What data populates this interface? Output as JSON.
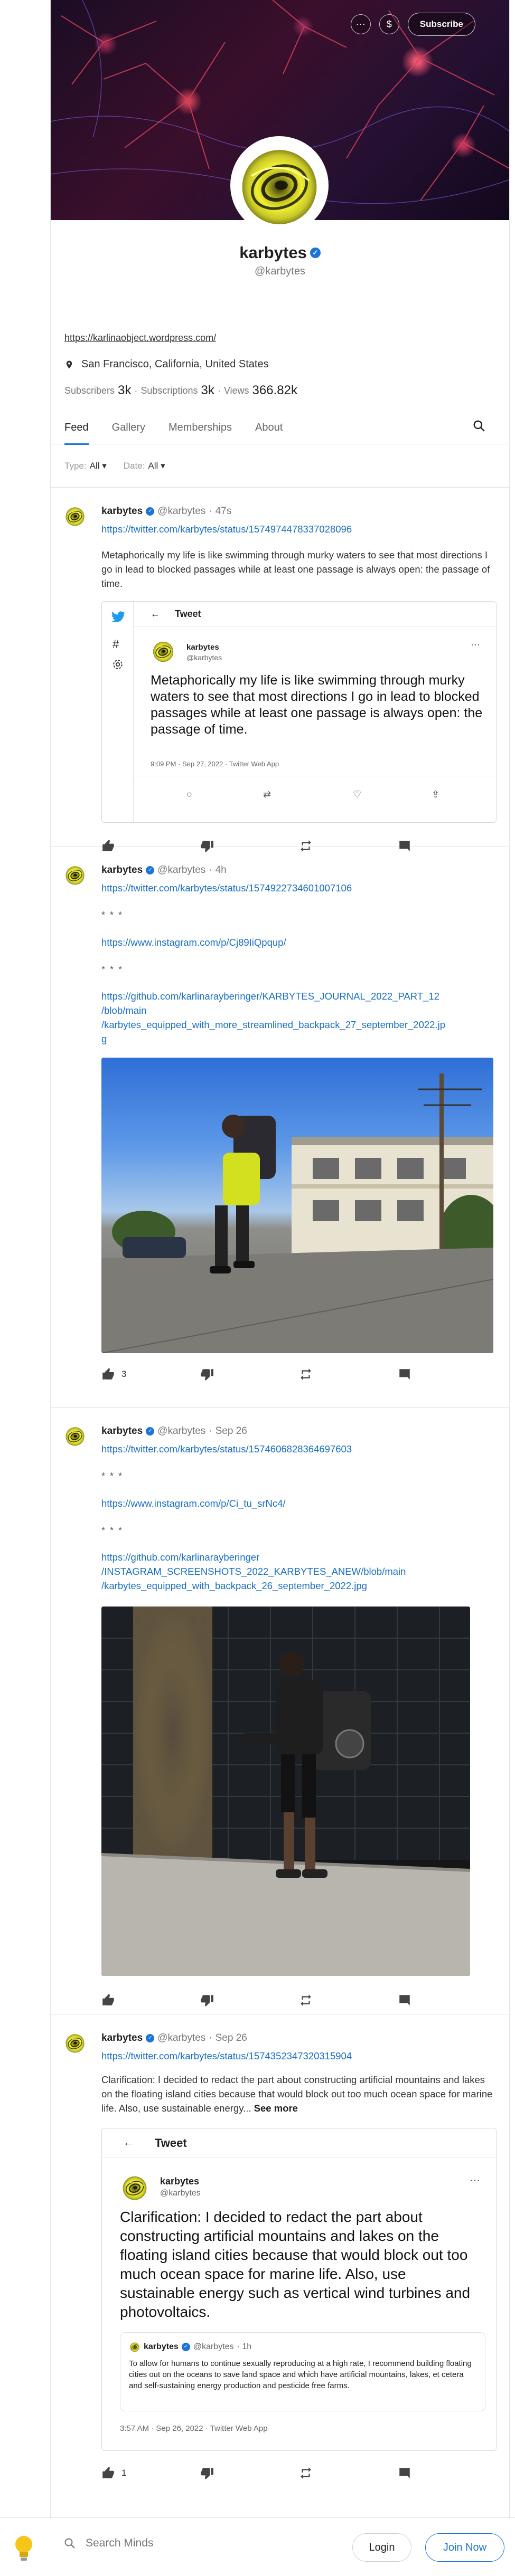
{
  "header": {
    "subscribe_label": "Subscribe",
    "more_icon": "more-horizontal-icon",
    "tip_icon": "dollar-icon"
  },
  "profile": {
    "name": "karbytes",
    "handle": "@karbytes",
    "website": "https://karlinaobject.wordpress.com/",
    "location": "San Francisco, California, United States",
    "subscribers_label": "Subscribers",
    "subscribers": "3k",
    "subscriptions_label": "Subscriptions",
    "subscriptions": "3k",
    "views_label": "Views",
    "views": "366.82k"
  },
  "tabs": [
    "Feed",
    "Gallery",
    "Memberships",
    "About"
  ],
  "filters": {
    "type_label": "Type:",
    "type_value": "All",
    "date_label": "Date:",
    "date_value": "All"
  },
  "posts": [
    {
      "name": "karbytes",
      "handle": "@karbytes",
      "time": "47s",
      "link": "https://twitter.com/karbytes/status/1574974478337028096",
      "text": "Metaphorically my life is like swimming through murky waters to see that most directions I go in lead to blocked passages while at least one passage is always open: the passage of time.",
      "embed": {
        "header": "Tweet",
        "name": "karbytes",
        "handle": "@karbytes",
        "text": "Metaphorically my life is like swimming through murky waters to see that most directions I go in lead to blocked passages while at least one passage is always open: the passage of time.",
        "meta": "9:09 PM · Sep 27, 2022 · Twitter Web App"
      },
      "likes": ""
    },
    {
      "name": "karbytes",
      "handle": "@karbytes",
      "time": "4h",
      "link": "https://twitter.com/karbytes/status/1574922734601007106",
      "stars1": "* * *",
      "link2": "https://www.instagram.com/p/Cj89IiQpqup/",
      "stars2": "* * *",
      "link3_lines": [
        "https://github.com/karlinarayberinger/KARBYTES_JOURNAL_2022_PART_12",
        "/blob/main",
        "/karbytes_equipped_with_more_streamlined_backpack_27_september_2022.jp",
        "g"
      ],
      "likes": "3"
    },
    {
      "name": "karbytes",
      "handle": "@karbytes",
      "time": "Sep 26",
      "link": "https://twitter.com/karbytes/status/1574606828364697603",
      "stars1": "* * *",
      "link2": "https://www.instagram.com/p/Ci_tu_srNc4/",
      "stars2": "* * *",
      "link3_lines": [
        "https://github.com/karlinarayberinger",
        "/INSTAGRAM_SCREENSHOTS_2022_KARBYTES_ANEW/blob/main",
        "/karbytes_equipped_with_backpack_26_september_2022.jpg"
      ],
      "likes": ""
    },
    {
      "name": "karbytes",
      "handle": "@karbytes",
      "time": "Sep 26",
      "link": "https://twitter.com/karbytes/status/1574352347320315904",
      "text": "Clarification: I decided to redact the part about constructing artificial mountains and lakes on the floating island cities because that would block out too much ocean space for marine life. Also, use sustainable energy...",
      "see_more": "See more",
      "embed": {
        "header": "Tweet",
        "name": "karbytes",
        "handle": "@karbytes",
        "text": "Clarification: I decided to redact the part about constructing artificial mountains and lakes on the floating island cities because that would block out too much ocean space for marine life. Also, use sustainable energy such as vertical wind turbines and photovoltaics.",
        "quote_name": "karbytes",
        "quote_handle": "@karbytes",
        "quote_time": "· 1h",
        "quote_text": "To allow for humans to continue sexually reproducing at a high rate, I recommend building floating cities out on the oceans to save land space and which have artificial mountains, lakes, et cetera and self-sustaining energy production and pesticide free farms.",
        "meta": "3:57 AM · Sep 26, 2022 · Twitter Web App"
      },
      "likes": "1"
    }
  ],
  "bottom": {
    "search_placeholder": "Search Minds",
    "login_label": "Login",
    "join_label": "Join Now"
  },
  "colors": {
    "accent": "#1d74d8",
    "link": "#1a6fc4",
    "twitter": "#1d9bf0",
    "border": "#e3e3e3"
  }
}
